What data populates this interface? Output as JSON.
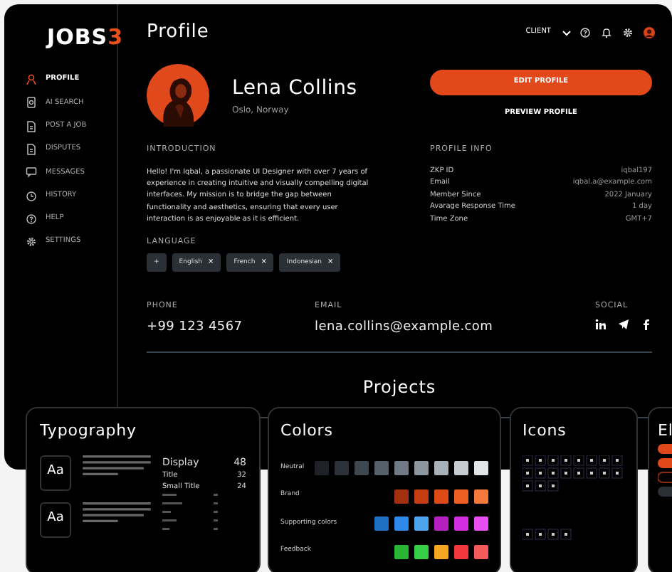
{
  "logo": {
    "text": "JOBS",
    "accent": "3"
  },
  "sidebar": {
    "items": [
      {
        "label": "PROFILE",
        "selected": true
      },
      {
        "label": "AI SEARCH",
        "selected": false
      },
      {
        "label": "POST A JOB",
        "selected": false
      },
      {
        "label": "DISPUTES",
        "selected": false
      },
      {
        "label": "MESSAGES",
        "selected": false
      },
      {
        "label": "HISTORY",
        "selected": false
      },
      {
        "label": "HELP",
        "selected": false
      },
      {
        "label": "SETTINGS",
        "selected": false
      }
    ]
  },
  "header": {
    "title": "Profile",
    "role": "CLIENT"
  },
  "profile": {
    "name": "Lena Collins",
    "location": "Oslo, Norway",
    "edit_button": "EDIT PROFILE",
    "preview_link": "PREVIEW PROFILE"
  },
  "introduction": {
    "heading": "INTRODUCTION",
    "text": "Hello! I'm Iqbal, a passionate UI Designer with over 7 years of experience in creating intuitive and visually compelling digital interfaces. My mission is to bridge the gap between functionality and aesthetics, ensuring that every user interaction is as enjoyable as it is efficient."
  },
  "profile_info": {
    "heading": "PROFILE INFO",
    "rows": [
      {
        "label": "ZKP ID",
        "value": "iqbal197"
      },
      {
        "label": "Email",
        "value": "iqbal.a@example.com"
      },
      {
        "label": "Member Since",
        "value": "2022 January"
      },
      {
        "label": "Avarage Response Time",
        "value": "1 day"
      },
      {
        "label": "Time Zone",
        "value": "GMT+7"
      }
    ]
  },
  "language": {
    "heading": "LANGUAGE",
    "add": "+",
    "chips": [
      "English",
      "French",
      "Indonesian"
    ],
    "remove": "×"
  },
  "contact": {
    "phone_label": "PHONE",
    "phone": "+99 123 4567",
    "email_label": "EMAIL",
    "email": "lena.collins@example.com",
    "social_label": "SOCIAL"
  },
  "projects": {
    "heading": "Projects"
  },
  "typography": {
    "title": "Typography",
    "samples": [
      "Aa",
      "Aa"
    ],
    "scale": [
      {
        "name": "Display",
        "size": "48"
      },
      {
        "name": "Title",
        "size": "32"
      },
      {
        "name": "Small Title",
        "size": "24"
      }
    ]
  },
  "colors": {
    "title": "Colors",
    "rows": [
      {
        "label": "Neutral",
        "swatches": [
          {
            "color": "#1e2226"
          },
          {
            "color": "#2b3136"
          },
          {
            "color": "#3f474e"
          },
          {
            "color": "#56606a"
          },
          {
            "color": "#6f7a85"
          },
          {
            "color": "#8c969f"
          },
          {
            "color": "#a9b1b8"
          },
          {
            "color": "#c6ccd1"
          },
          {
            "color": "#e1e5e8"
          }
        ]
      },
      {
        "label": "Brand",
        "swatches": [
          {
            "color": "#a3300f"
          },
          {
            "color": "#c43c12"
          },
          {
            "color": "#dd4a16"
          },
          {
            "color": "#ee5f26"
          },
          {
            "color": "#f4773c"
          }
        ]
      },
      {
        "label": "Supporting colors",
        "swatches": [
          {
            "color": "#1f6fc4"
          },
          {
            "color": "#2d8ae8"
          },
          {
            "color": "#4ea3ef"
          },
          {
            "color": "#b51fc0"
          },
          {
            "color": "#d22ee0"
          },
          {
            "color": "#e84df0"
          }
        ]
      },
      {
        "label": "Feedback",
        "swatches": [
          {
            "color": "#28b533"
          },
          {
            "color": "#35d047"
          },
          {
            "color": "#f5a623"
          },
          {
            "color": "#f0373a"
          },
          {
            "color": "#f55a5a"
          }
        ]
      }
    ]
  },
  "icons": {
    "title": "Icons"
  },
  "elements": {
    "title": "El"
  }
}
